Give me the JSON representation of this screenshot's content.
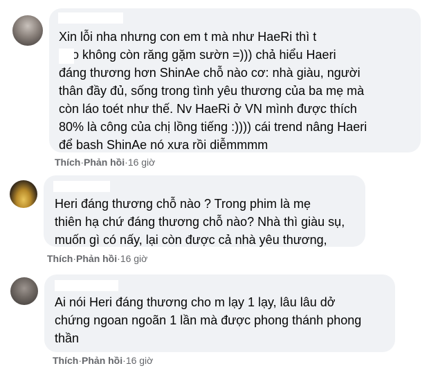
{
  "comments": [
    {
      "text": "Xin lỗi nha nhưng con em t mà như HaeRi thì t\n     cho không còn răng gặm sườn =))) chả hiểu Haeri\nđáng thương hơn ShinAe chỗ nào cơ: nhà giàu, người\nthân đầy đủ, sống trong tình yêu thương của ba mẹ mà\ncòn láo toét như thế. Nv HaeRi ở VN mình được thích\n80% là công của chị lồng tiếng :)))) cái trend nâng Haeri\nđể bash ShinAe nó xưa rồi diễmmmm",
      "like": "Thích",
      "reply": "Phản hồi",
      "time": "16 giờ"
    },
    {
      "text": "Heri đáng thương chỗ nào ? Trong phim là mẹ\nthiên hạ chứ đáng thương chỗ nào? Nhà thì giàu sụ,\nmuốn gì có nấy, lại còn được cả nhà yêu thương,",
      "like": "Thích",
      "reply": "Phản hồi",
      "time": "16 giờ"
    },
    {
      "text": "Ai nói Heri đáng thương cho m lạy 1 lạy, lâu lâu dở\nchứng ngoan ngoãn 1 lần mà được phong thánh phong\nthần",
      "like": "Thích",
      "reply": "Phản hồi",
      "time": "16 giờ"
    }
  ],
  "separator": " · ",
  "colors": {
    "bubble": "#f0f2f5",
    "text": "#050505",
    "meta": "#65676b"
  }
}
